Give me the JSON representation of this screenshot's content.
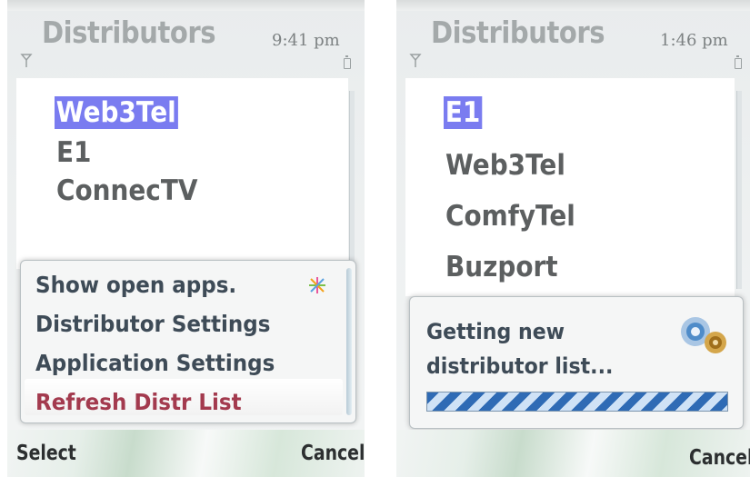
{
  "left_screen": {
    "title": "Distributors",
    "time": "9:41 pm",
    "list": [
      {
        "label": "Web3Tel",
        "selected": true
      },
      {
        "label": "E1",
        "selected": false
      },
      {
        "label": "ConnecTV",
        "selected": false
      }
    ],
    "menu": {
      "items": [
        {
          "label": "Show open apps.",
          "icon": "sparkle-icon"
        },
        {
          "label": "Distributor Settings"
        },
        {
          "label": "Application Settings"
        },
        {
          "label": "Refresh Distr List",
          "active": true
        }
      ]
    },
    "softkeys": {
      "left": "Select",
      "right": "Cancel"
    }
  },
  "right_screen": {
    "title": "Distributors",
    "time": "1:46 pm",
    "list": [
      {
        "label": "E1",
        "selected": true
      },
      {
        "label": "Web3Tel",
        "selected": false
      },
      {
        "label": "ComfyTel",
        "selected": false
      },
      {
        "label": "Buzport",
        "selected": false
      }
    ],
    "progress": {
      "line1": "Getting new",
      "line2": "distributor list...",
      "icon": "gears-icon",
      "fraction": 1.0
    },
    "softkeys": {
      "right": "Cancel"
    }
  },
  "colors": {
    "highlight": "#7a7cf0",
    "active_menu_text": "#a33a4e",
    "progress_blue": "#2f6bb5"
  }
}
